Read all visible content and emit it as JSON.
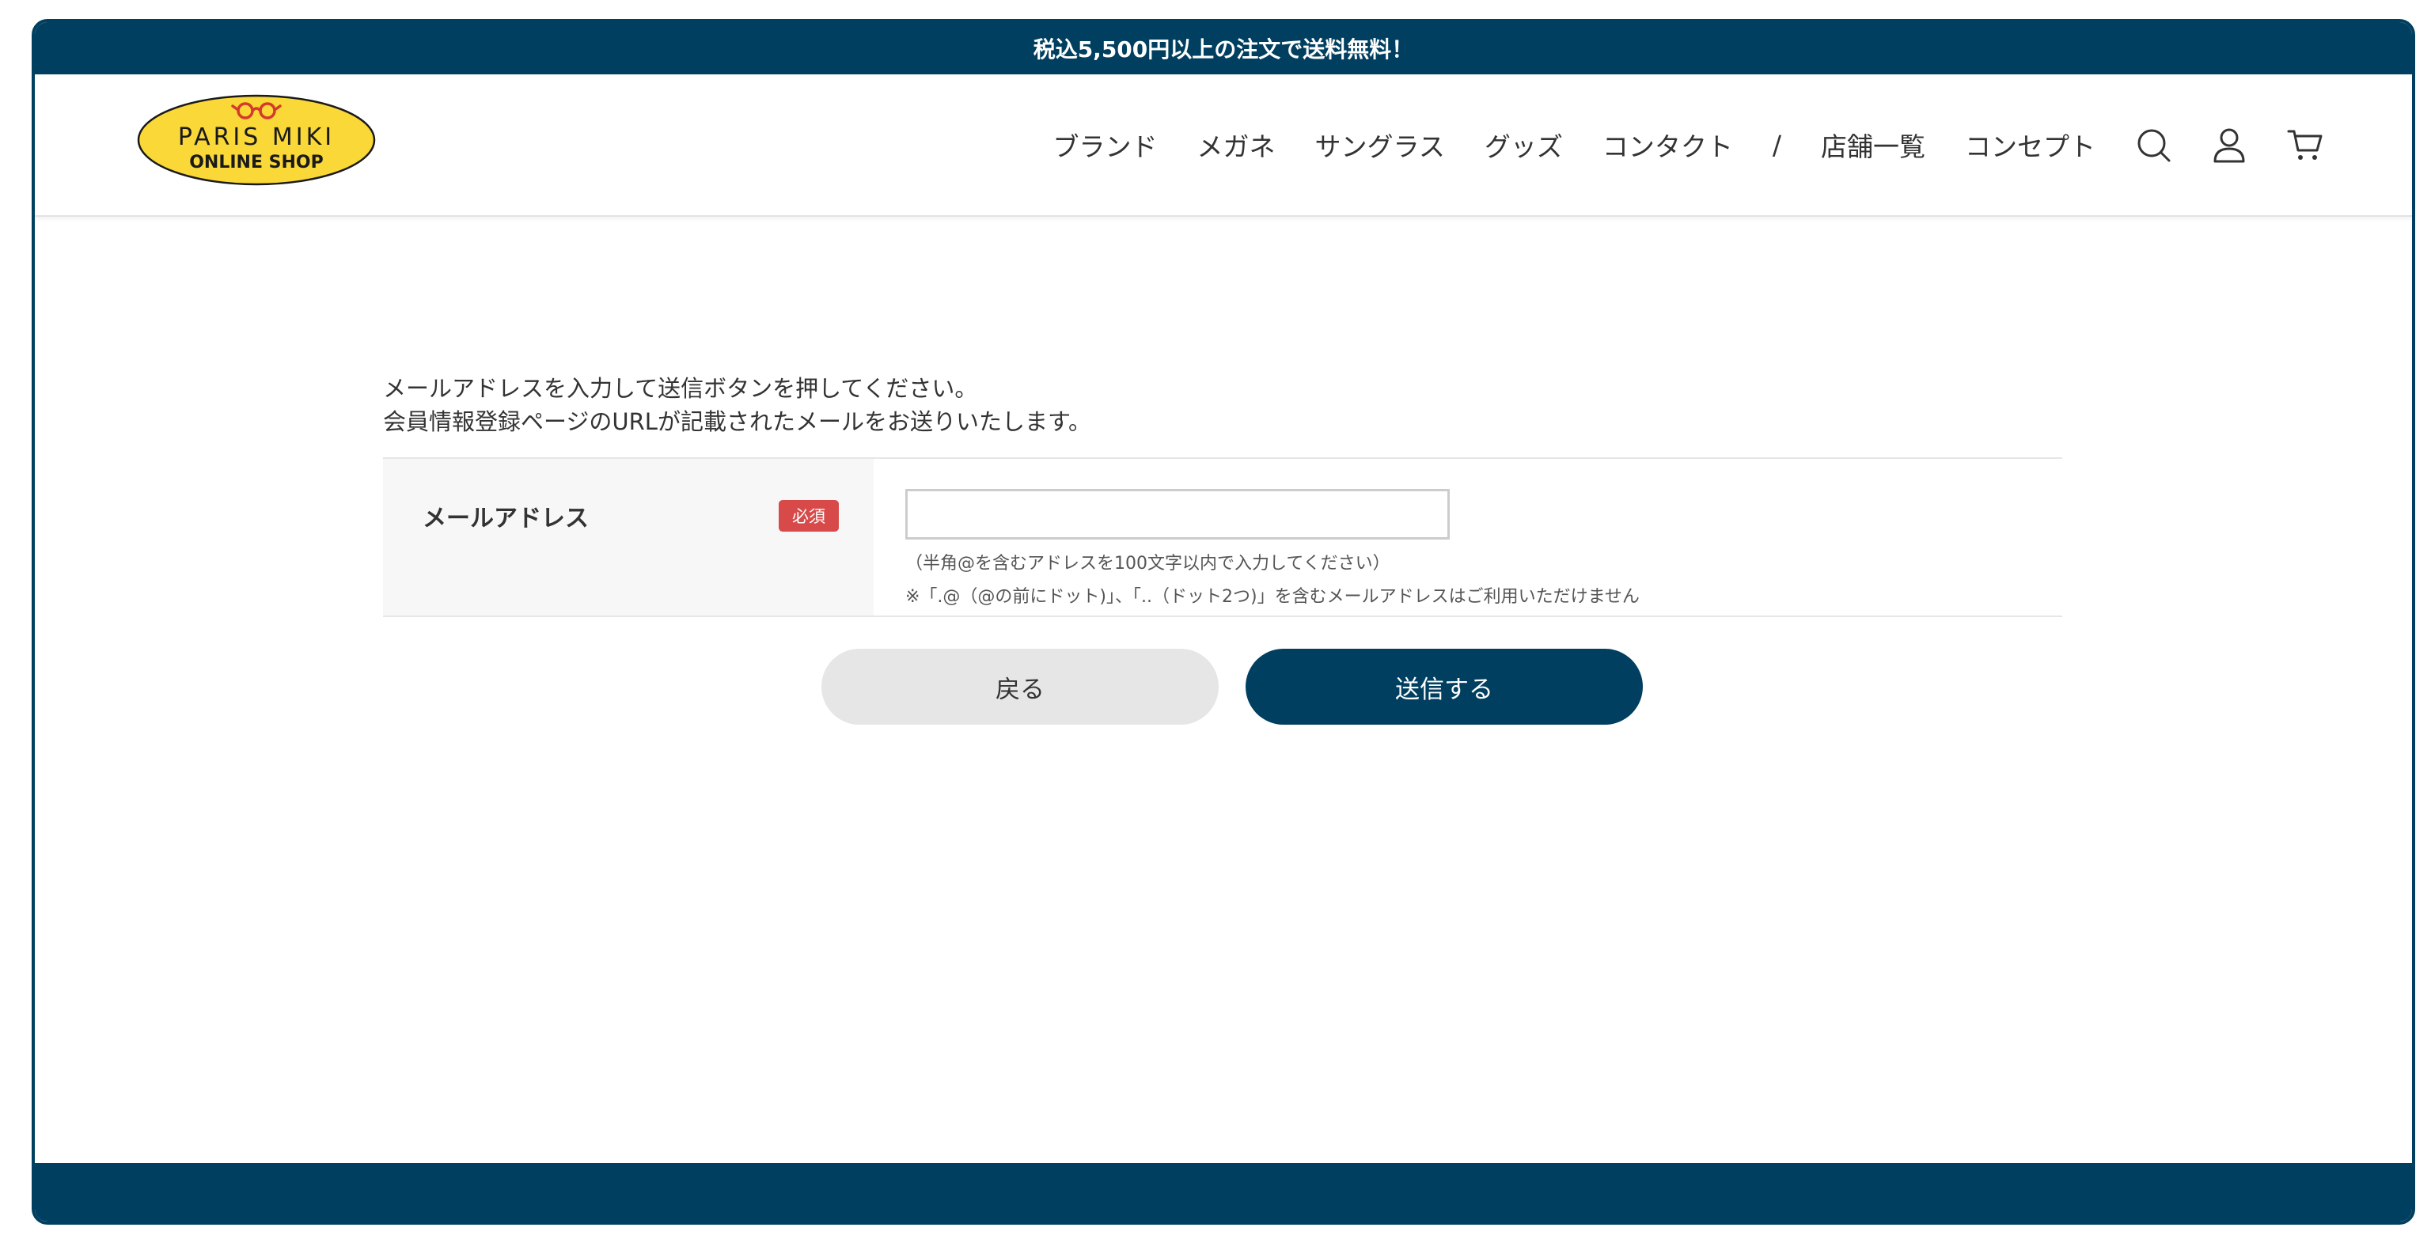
{
  "announcement": "税込5,500円以上の注文で送料無料！",
  "logo": {
    "line1": "PARIS MIKI",
    "line2": "ONLINE SHOP",
    "bg_color": "#f9d838",
    "glasses_color": "#d33a2c"
  },
  "nav": {
    "items": [
      "ブランド",
      "メガネ",
      "サングラス",
      "グッズ",
      "コンタクト"
    ],
    "separator": "/",
    "items2": [
      "店舗一覧",
      "コンセプト"
    ],
    "icons": [
      "search-icon",
      "user-icon",
      "cart-icon"
    ]
  },
  "intro": {
    "line1": "メールアドレスを入力して送信ボタンを押してください。",
    "line2": "会員情報登録ページのURLが記載されたメールをお送りいたします。"
  },
  "form": {
    "label": "メールアドレス",
    "required": "必須",
    "value": "",
    "hint1": "（半角@を含むアドレスを100文字以内で入力してください）",
    "hint2": "※「.@（@の前にドット)」、「..（ドット2つ)」を含むメールアドレスはご利用いただけません"
  },
  "buttons": {
    "back": "戻る",
    "submit": "送信する"
  },
  "colors": {
    "primary": "#003f5f",
    "required": "#d84a4a",
    "label_bg": "#f7f7f7",
    "back_btn": "#e6e6e6"
  }
}
